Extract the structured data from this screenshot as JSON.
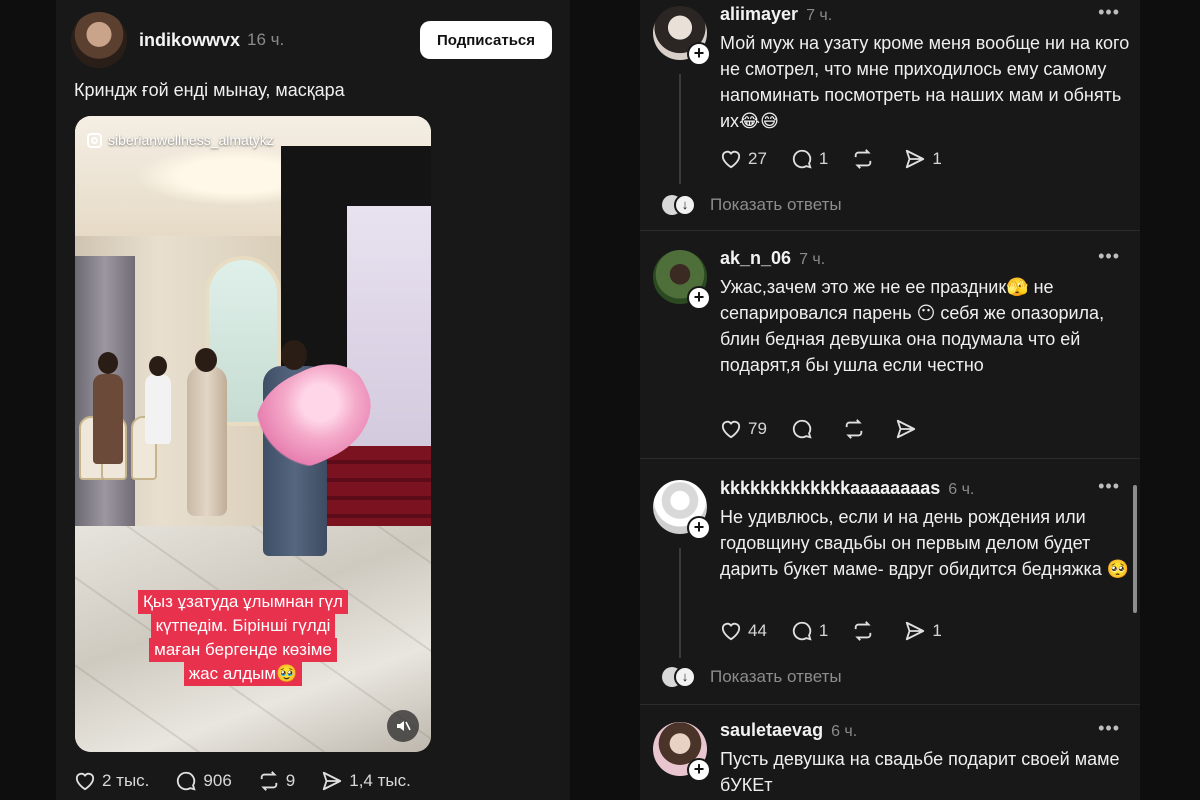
{
  "post": {
    "username": "indikowwvx",
    "time": "16 ч.",
    "subscribe_label": "Подписаться",
    "caption": "Криндж ғой енді мынау, масқара",
    "media": {
      "watermark": "siberianwellness_almatykz",
      "overlay_lines": [
        "Қыз ұзатуда ұлымнан гүл",
        "күтпедім. Бірінші гүлді",
        "маған бергенде көзіме",
        "жас алдым🥹"
      ],
      "mute_icon": "speaker-muted-icon"
    },
    "actions": {
      "likes": "2 тыс.",
      "comments": "906",
      "reposts": "9",
      "shares": "1,4 тыс."
    }
  },
  "comments": [
    {
      "username": "aliimayer",
      "time": "7 ч.",
      "text": "Мой муж на узату кроме меня вообще ни на кого не смотрел, что мне приходилось ему самому напоминать посмотреть на наших мам и обнять их😂😅",
      "likes": "27",
      "replies": "1",
      "reposts": "",
      "shares": "1",
      "show_replies": "Показать ответы"
    },
    {
      "username": "ak_n_06",
      "time": "7 ч.",
      "text": "Ужас,зачем это же не ее праздник🫣 не сепарировался парень 😶 себя же опазорила, блин бедная девушка она подумала что ей подарят,я бы ушла если честно",
      "likes": "79",
      "replies": "",
      "reposts": "",
      "shares": "",
      "show_replies": ""
    },
    {
      "username": "kkkkkkkkkkkkkaaaaaaaas",
      "time": "6 ч.",
      "text": "Не удивлюсь, если и на день рождения или годовщину свадьбы он первым делом будет дарить букет маме- вдруг обидится бедняжка 🥺",
      "likes": "44",
      "replies": "1",
      "reposts": "",
      "shares": "1",
      "show_replies": "Показать ответы"
    },
    {
      "username": "sauletaevag",
      "time": "6 ч.",
      "text": "Пусть девушка на свадьбе подарит своей маме бУКЕт",
      "likes": "",
      "replies": "",
      "reposts": "",
      "shares": "",
      "show_replies": ""
    }
  ],
  "colors": {
    "background": "#0e0e0e",
    "panel": "#181818",
    "overlay_red": "#e8314d",
    "muted_text": "#8a8a8a"
  }
}
